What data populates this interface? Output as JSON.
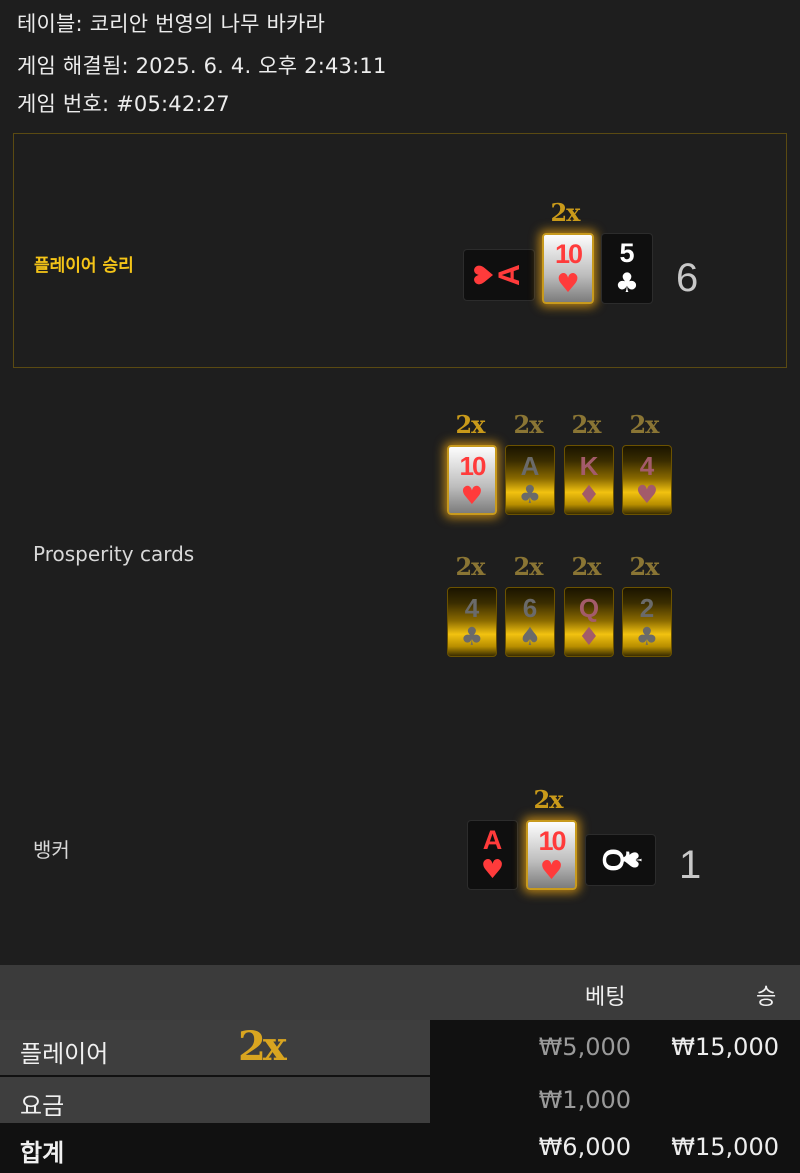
{
  "header": {
    "table_line": "테이블: 코리안 번영의 나무 바카라",
    "resolved_line": "게임 해결됨: 2025. 6. 4. 오후 2:43:11",
    "game_no_line": "게임 번호: #05:42:27"
  },
  "player": {
    "label": "플레이어 승리",
    "multiplier": "2x",
    "cards": [
      {
        "rank": "A",
        "suit": "♥",
        "state": "rotated-dark"
      },
      {
        "rank": "10",
        "suit": "♥",
        "state": "highlight"
      },
      {
        "rank": "5",
        "suit": "♣",
        "state": "dark"
      }
    ],
    "total": "6"
  },
  "prosperity": {
    "label": "Prosperity cards",
    "row1": [
      {
        "rank": "10",
        "suit": "♥",
        "mult": "2x",
        "state": "highlight"
      },
      {
        "rank": "A",
        "suit": "♣",
        "mult": "2x",
        "state": "gold"
      },
      {
        "rank": "K",
        "suit": "♦",
        "mult": "2x",
        "state": "gold"
      },
      {
        "rank": "4",
        "suit": "♥",
        "mult": "2x",
        "state": "gold"
      }
    ],
    "row2": [
      {
        "rank": "4",
        "suit": "♣",
        "mult": "2x",
        "state": "gold"
      },
      {
        "rank": "6",
        "suit": "♠",
        "mult": "2x",
        "state": "gold"
      },
      {
        "rank": "Q",
        "suit": "♦",
        "mult": "2x",
        "state": "gold"
      },
      {
        "rank": "2",
        "suit": "♣",
        "mult": "2x",
        "state": "gold"
      }
    ]
  },
  "banker": {
    "label": "뱅커",
    "multiplier": "2x",
    "cards": [
      {
        "rank": "A",
        "suit": "♥",
        "state": "dark"
      },
      {
        "rank": "10",
        "suit": "♥",
        "state": "highlight"
      },
      {
        "rank": "Q",
        "suit": "♠",
        "state": "rotated-dark"
      }
    ],
    "total": "1"
  },
  "summary": {
    "col_bet": "베팅",
    "col_win": "승",
    "rows": [
      {
        "label": "플레이어",
        "multiplier": "2x",
        "bet": "₩5,000",
        "win": "₩15,000"
      },
      {
        "label": "요금",
        "bet": "₩1,000",
        "win": ""
      },
      {
        "label": "합계",
        "bet": "₩6,000",
        "win": "₩15,000"
      }
    ]
  },
  "colors": {
    "background": "#1e1e1e",
    "accent_gold": "#f5c518",
    "heart_red": "#ff3b3b"
  }
}
